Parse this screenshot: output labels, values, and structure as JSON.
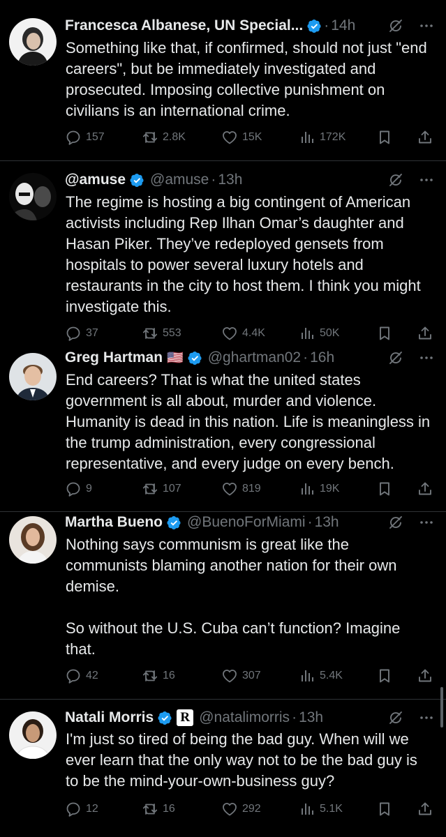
{
  "colors": {
    "background": "#000000",
    "text": "#e7e9ea",
    "muted": "#71767b",
    "verified_blue": "#1d9bf0",
    "divider": "#2f3336"
  },
  "tweets": [
    {
      "name": "Francesca Albanese, UN Special...",
      "handle": "",
      "time": "14h",
      "text": "Something like that, if confirmed, should not just \"end careers\", but be immediately investigated and prosecuted. Imposing collective punishment on civilians is an international crime.",
      "replies": "157",
      "reposts": "2.8K",
      "likes": "15K",
      "views": "172K"
    },
    {
      "name": "@amuse",
      "handle": "@amuse",
      "time": "13h",
      "text": "The regime is hosting a big contingent of American activists including Rep Ilhan Omar’s daughter and Hasan Piker. They’ve redeployed gensets from hospitals to power several luxury hotels and restaurants in the city to host them. I think you might investigate this.",
      "replies": "37",
      "reposts": "553",
      "likes": "4.4K",
      "views": "50K"
    },
    {
      "name": "Greg Hartman",
      "flag": "🇺🇸",
      "handle": "@ghartman02",
      "time": "16h",
      "text": "End careers? That is what the united states government is all about, murder and violence. Humanity is dead in this nation. Life is meaningless in the trump administration, every congressional representative, and every judge on every bench.",
      "replies": "9",
      "reposts": "107",
      "likes": "819",
      "views": "19K"
    },
    {
      "name": "Martha Bueno",
      "handle": "@BuenoForMiami",
      "time": "13h",
      "text": "Nothing says communism is great like the communists blaming another nation for their own demise.\n\nSo without the U.S. Cuba can’t function? Imagine that.",
      "replies": "42",
      "reposts": "16",
      "likes": "307",
      "views": "5.4K"
    },
    {
      "name": "Natali Morris",
      "affiliate_badge": "R",
      "handle": "@natalimorris",
      "time": "13h",
      "text": "I'm just so tired of being the bad guy. When will we ever learn that the only way not to be the bad guy is to be the mind-your-own-business guy?",
      "replies": "12",
      "reposts": "16",
      "likes": "292",
      "views": "5.1K"
    }
  ],
  "icons": [
    "verified-badge-icon",
    "grok-icon",
    "more-icon",
    "reply-icon",
    "repost-icon",
    "like-icon",
    "views-icon",
    "bookmark-icon",
    "share-icon"
  ]
}
